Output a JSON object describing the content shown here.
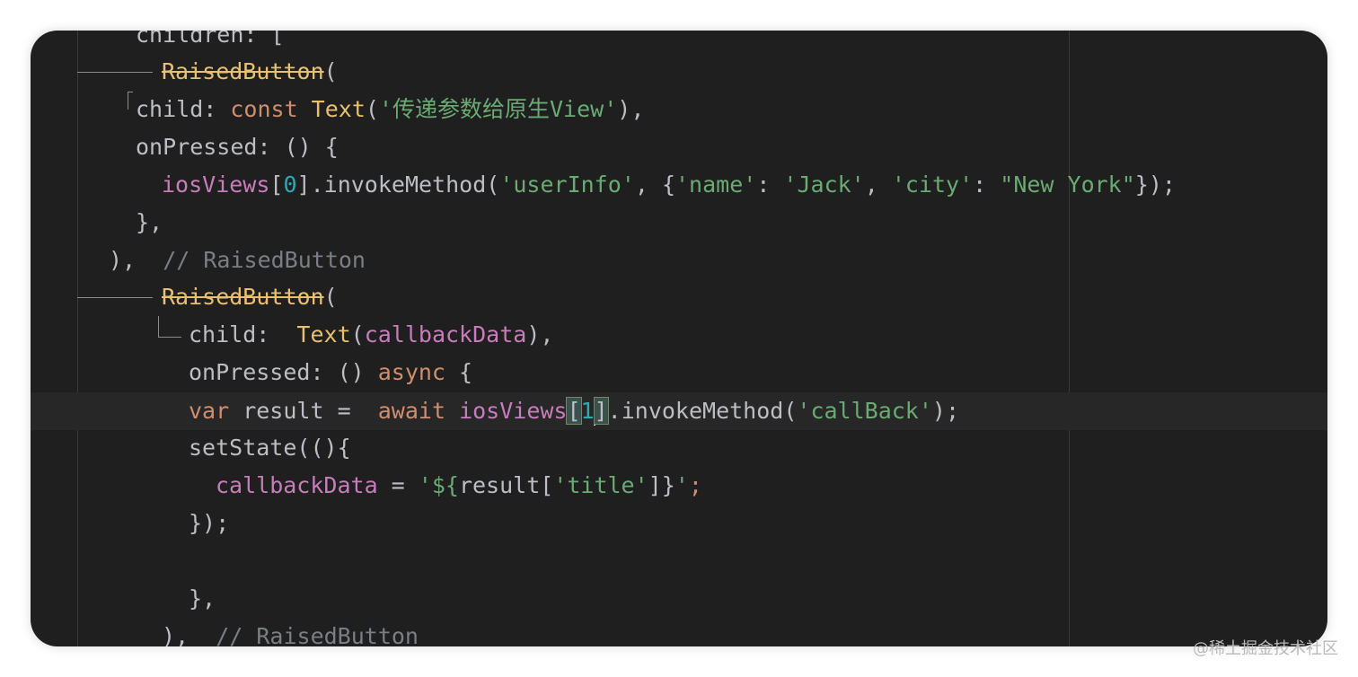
{
  "lines": {
    "l0": {
      "a": "children: ["
    },
    "l1": {
      "a": "RaisedButton",
      "b": "("
    },
    "l2": {
      "a": "child: ",
      "b": "const ",
      "c": "Text",
      "d": "(",
      "e": "'传递参数给原生View'",
      "f": "),"
    },
    "l3": {
      "a": "onPressed: () {"
    },
    "l4": {
      "a": "iosViews",
      "b": "[",
      "c": "0",
      "d": "].invokeMethod(",
      "e": "'userInfo'",
      "f": ", {",
      "g": "'name'",
      "h": ": ",
      "i": "'Jack'",
      "j": ", ",
      "k": "'city'",
      "l": ": ",
      "m": "\"New York\"",
      "n": "});"
    },
    "l5": {
      "a": "},"
    },
    "l6": {
      "a": "),",
      "b": "// RaisedButton"
    },
    "l7": {
      "a": "RaisedButton",
      "b": "("
    },
    "l8": {
      "a": "child:  ",
      "b": "Text",
      "c": "(",
      "d": "callbackData",
      "e": "),"
    },
    "l9": {
      "a": "onPressed: () ",
      "b": "async",
      "c": " {"
    },
    "l10": {
      "a": "var",
      "b": " result =  ",
      "c": "await",
      "d": " ",
      "e": "iosViews",
      "f": "[",
      "g": "1",
      "h": "]",
      "i": ".invokeMethod(",
      "j": "'callBack'",
      "k": ");"
    },
    "l11": {
      "a": "setState((){"
    },
    "l12": {
      "a": "callbackData",
      "b": " = ",
      "c": "'${",
      "d": "result[",
      "e": "'title'",
      "f": "]}",
      "g": "'",
      "h": ";"
    },
    "l13": {
      "a": "});"
    },
    "l14": {
      "a": "},"
    },
    "l15": {
      "a": "),",
      "b": "// RaisedButton"
    }
  },
  "watermark": "@稀土掘金技术社区",
  "colors": {
    "background": "#1f1f1f",
    "keyword": "#cf8e6d",
    "string": "#6aab73",
    "number": "#2aacb8",
    "function": "#e8c06f",
    "property": "#c77dbb",
    "comment": "#7a7e85",
    "text": "#bcbec4"
  }
}
